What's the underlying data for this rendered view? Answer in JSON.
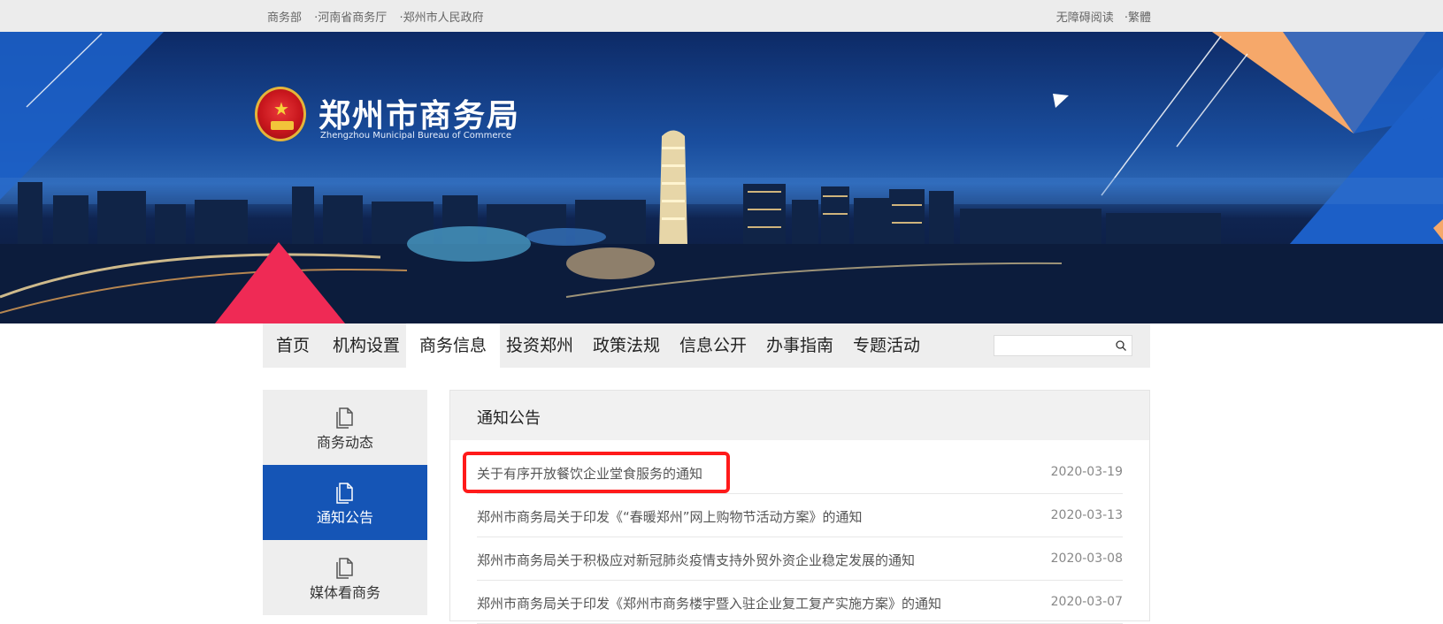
{
  "topbar": {
    "links_left": [
      "商务部",
      "·河南省商务厅",
      "·郑州市人民政府"
    ],
    "links_right": [
      "无障碍阅读",
      "·繁體"
    ]
  },
  "header": {
    "title": "郑州市商务局",
    "subtitle": "Zhengzhou Municipal Bureau of Commerce",
    "emblem_icon": "national-emblem"
  },
  "nav": {
    "items": [
      "首页",
      "机构设置",
      "商务信息",
      "投资郑州",
      "政策法规",
      "信息公开",
      "办事指南",
      "专题活动"
    ],
    "active_index": 2,
    "search": {
      "value": "",
      "placeholder": "",
      "icon": "search-icon"
    }
  },
  "sidebar": {
    "items": [
      {
        "label": "商务动态",
        "icon": "document-icon",
        "active": false
      },
      {
        "label": "通知公告",
        "icon": "document-icon",
        "active": true
      },
      {
        "label": "媒体看商务",
        "icon": "document-icon",
        "active": false
      }
    ]
  },
  "notices": {
    "title": "通知公告",
    "items": [
      {
        "title": "关于有序开放餐饮企业堂食服务的通知",
        "date": "2020-03-19"
      },
      {
        "title": "郑州市商务局关于印发《“春暖郑州”网上购物节活动方案》的通知",
        "date": "2020-03-13"
      },
      {
        "title": "郑州市商务局关于积极应对新冠肺炎疫情支持外贸外资企业稳定发展的通知",
        "date": "2020-03-08"
      },
      {
        "title": "郑州市商务局关于印发《郑州市商务楼宇暨入驻企业复工复产实施方案》的通知",
        "date": "2020-03-07"
      }
    ]
  },
  "colors": {
    "accent_blue": "#1555b6",
    "highlight_red": "#ff1a1a",
    "banner_orange": "#f6a86a",
    "banner_pink": "#ef2a55"
  }
}
